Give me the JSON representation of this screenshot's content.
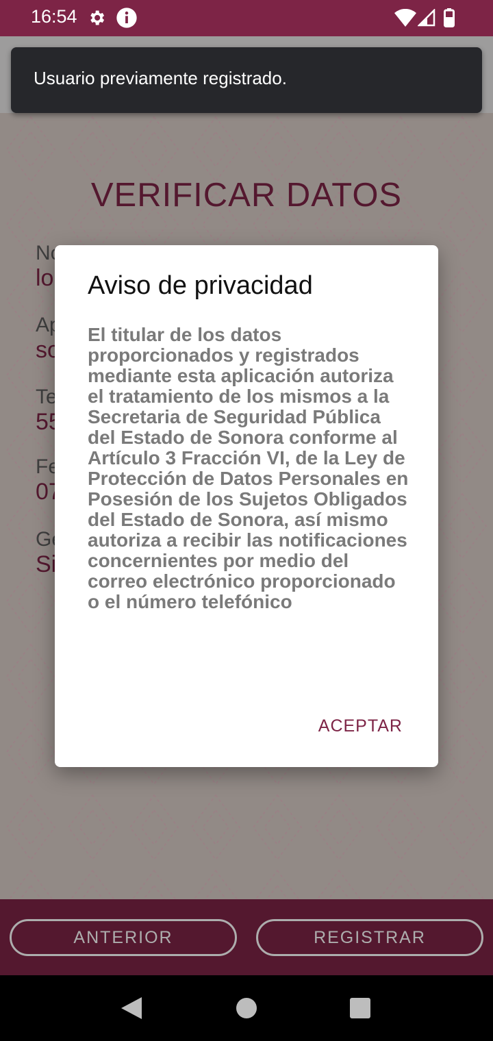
{
  "status_bar": {
    "time": "16:54",
    "icons": [
      "gear-icon",
      "info-icon",
      "wifi-icon",
      "signal-icon",
      "battery-icon"
    ]
  },
  "snackbar": {
    "message": "Usuario previamente registrado."
  },
  "page": {
    "title": "VERIFICAR DATOS",
    "fields": [
      {
        "label": "No",
        "value": "lo"
      },
      {
        "label": "Ap",
        "value": "so"
      },
      {
        "label": "Te",
        "value": "55"
      },
      {
        "label": "Fe",
        "value": "07"
      },
      {
        "label": "Ge",
        "value": "Si"
      }
    ]
  },
  "dialog": {
    "title": "Aviso de privacidad",
    "body": "El titular de los datos proporcionados y registrados mediante esta aplicación autoriza el tratamiento de los mismos a la Secretaria de Seguridad Pública del Estado de Sonora conforme al Artículo 3 Fracción VI, de la Ley de Protección de Datos Personales en Posesión de los Sujetos Obligados del Estado de Sonora, así mismo autoriza a recibir las notificaciones concernientes por medio del correo electrónico proporcionado o el número telefónico",
    "accept_label": "ACEPTAR"
  },
  "bottom_bar": {
    "prev_label": "ANTERIOR",
    "next_label": "REGISTRAR"
  },
  "nav_bar": {
    "icons": [
      "back-icon",
      "home-icon",
      "recents-icon"
    ]
  },
  "colors": {
    "brand": "#7d2446",
    "background": "#d8ccc6",
    "snackbar": "#26272b"
  }
}
